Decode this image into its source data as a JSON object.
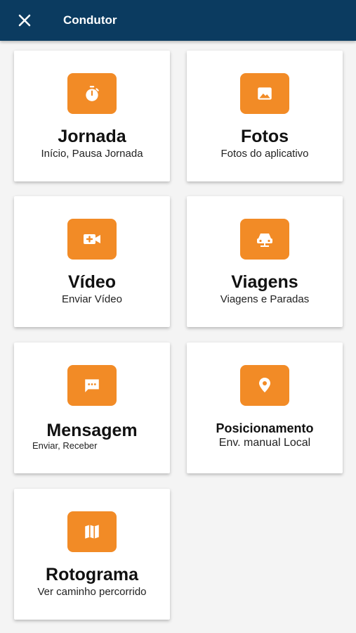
{
  "header": {
    "title": "Condutor",
    "close_icon": "close-icon"
  },
  "colors": {
    "header_bg": "#0b3b60",
    "icon_bg": "#f28b26",
    "card_bg": "#ffffff",
    "page_bg": "#f4f4f4"
  },
  "menu": {
    "jornada": {
      "title": "Jornada",
      "subtitle": "Início, Pausa Jornada",
      "icon": "stopwatch-icon"
    },
    "fotos": {
      "title": "Fotos",
      "subtitle": "Fotos do aplicativo",
      "icon": "image-icon"
    },
    "video": {
      "title": "Vídeo",
      "subtitle": "Enviar Vídeo",
      "icon": "video-add-icon"
    },
    "viagens": {
      "title": "Viagens",
      "subtitle": "Viagens e Paradas",
      "icon": "car-icon"
    },
    "mensagem": {
      "title": "Mensagem",
      "subtitle": "Enviar, Receber",
      "icon": "message-icon"
    },
    "posicionamento": {
      "title": "Posicionamento",
      "subtitle": "Env. manual Local",
      "icon": "location-pin-icon"
    },
    "rotograma": {
      "title": "Rotograma",
      "subtitle": "Ver caminho percorrido",
      "icon": "map-icon"
    }
  }
}
